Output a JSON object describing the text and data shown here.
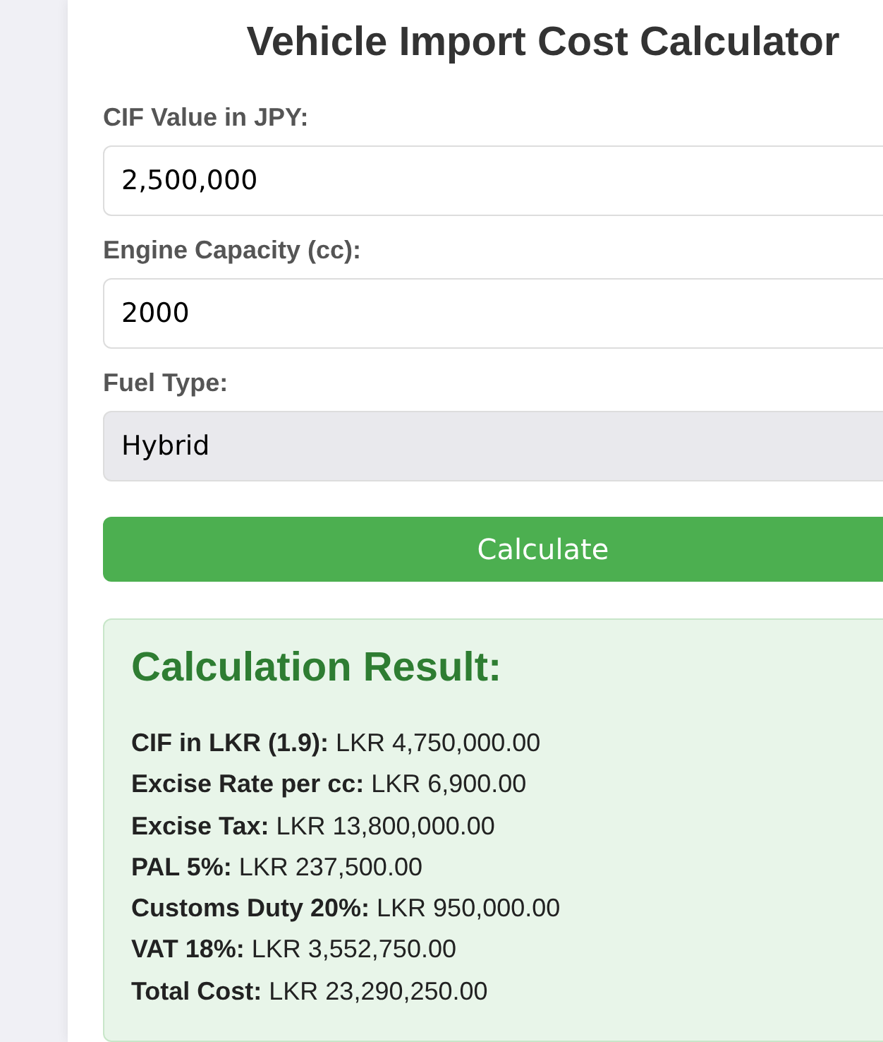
{
  "title": "Vehicle Import Cost Calculator",
  "fields": [
    {
      "kind": "text",
      "label": "CIF Value in JPY:",
      "value": "2,500,000"
    },
    {
      "kind": "text",
      "label": "Engine Capacity (cc):",
      "value": "2000"
    },
    {
      "kind": "select",
      "label": "Fuel Type:",
      "value": "Hybrid"
    }
  ],
  "button": "Calculate",
  "result": {
    "heading": "Calculation Result:",
    "lines": [
      "**CIF in LKR (1.9):** LKR 4,750,000.00",
      "**Excise Rate per cc:** LKR 6,900.00",
      "**Excise Tax:** LKR 13,800,000.00",
      "**PAL 5%:** LKR 237,500.00",
      "**Customs Duty 20%:** LKR 950,000.00",
      "**VAT 18%:** LKR 3,552,750.00",
      "**Total Cost:** LKR 23,290,250.00"
    ]
  }
}
